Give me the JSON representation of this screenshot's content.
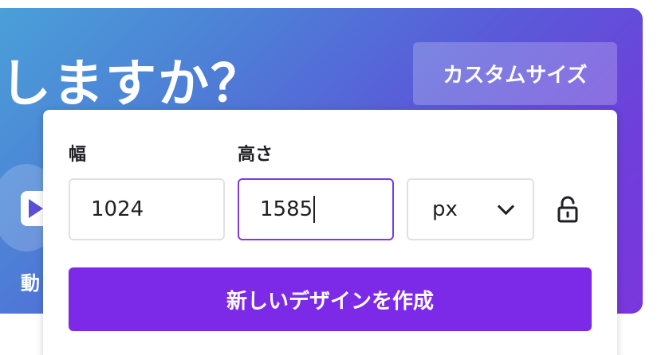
{
  "hero": {
    "title": "しますか？",
    "custom_size_label": "カスタムサイズ",
    "video_label": "動"
  },
  "panel": {
    "width_label": "幅",
    "width_value": "1024",
    "height_label": "高さ",
    "height_value": "1585",
    "unit_value": "px",
    "create_button_label": "新しいデザインを作成"
  },
  "icons": {
    "lock": "lock-open-icon",
    "chevron": "chevron-down-icon",
    "play": "play-icon"
  },
  "colors": {
    "accent": "#7d2ae8",
    "focus_border": "#7d3be2",
    "gradient_start": "#4aa0d8",
    "gradient_end": "#7a36dc"
  }
}
